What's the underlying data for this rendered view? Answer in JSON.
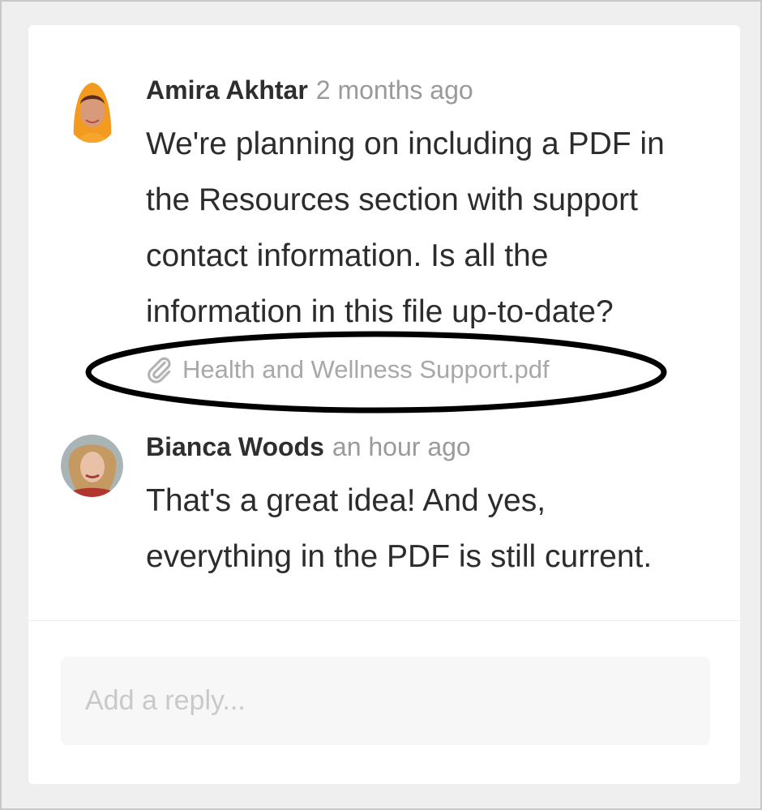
{
  "comments": [
    {
      "author": "Amira Akhtar",
      "time": "2 months ago",
      "lines": [
        "We're planning on including a PDF in",
        "the Resources section with support",
        "contact information. Is all the",
        "information in this file up-to-date?"
      ],
      "attachment": {
        "icon": "paperclip-icon",
        "filename": "Health and Wellness Support.pdf"
      }
    },
    {
      "author": "Bianca Woods",
      "time": "an hour ago",
      "lines": [
        "That's a great idea! And yes,",
        "everything in the PDF is still current."
      ]
    }
  ],
  "reply": {
    "placeholder": "Add a reply...",
    "value": ""
  },
  "colors": {
    "author": "#2e2e2e",
    "timestamp": "#9a9a9a",
    "attachment": "#a8a8a8",
    "highlight_outline": "#000000"
  }
}
